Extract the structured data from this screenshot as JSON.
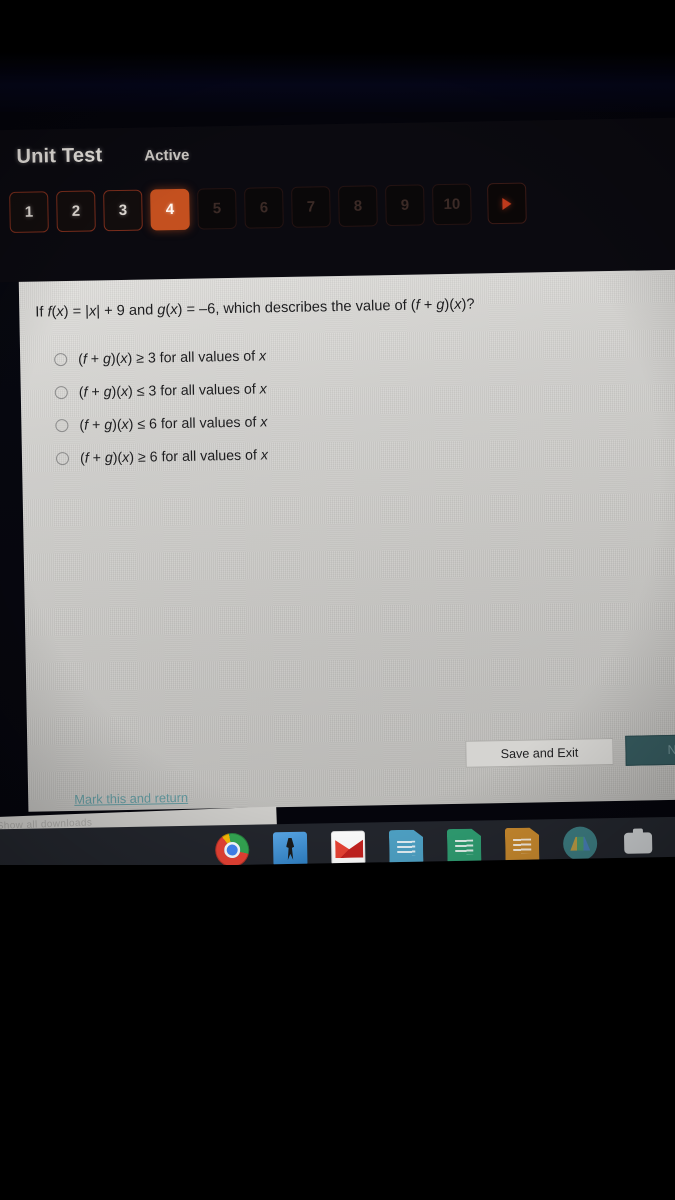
{
  "header": {
    "title": "Unit Test",
    "status": "Active"
  },
  "question_nav": {
    "items": [
      {
        "label": "1",
        "state": "available"
      },
      {
        "label": "2",
        "state": "available"
      },
      {
        "label": "3",
        "state": "available"
      },
      {
        "label": "4",
        "state": "active"
      },
      {
        "label": "5",
        "state": "dim"
      },
      {
        "label": "6",
        "state": "dim"
      },
      {
        "label": "7",
        "state": "dim"
      },
      {
        "label": "8",
        "state": "dim"
      },
      {
        "label": "9",
        "state": "dim"
      },
      {
        "label": "10",
        "state": "dim"
      }
    ],
    "next_icon": "triangle-right-icon"
  },
  "question": {
    "prompt_prefix": "If ",
    "prompt": "If f(x) = |x| + 9 and g(x) = –6, which describes the value of (f + g)(x)?",
    "options": [
      {
        "id": "a",
        "text": "(f + g)(x) ≥ 3 for all values of x",
        "selected": false
      },
      {
        "id": "b",
        "text": "(f + g)(x) ≤ 3 for all values of x",
        "selected": false
      },
      {
        "id": "c",
        "text": "(f + g)(x) ≤ 6 for all values of x",
        "selected": false
      },
      {
        "id": "d",
        "text": "(f + g)(x) ≥ 6 for all values of x",
        "selected": false
      }
    ]
  },
  "actions": {
    "save_and_exit": "Save and Exit",
    "next": "Next",
    "mark_and_return": "Mark this and return"
  },
  "download_bar": {
    "text": "Show all downloads"
  },
  "taskbar": {
    "icons": [
      {
        "name": "chrome-icon"
      },
      {
        "name": "app-icon"
      },
      {
        "name": "gmail-icon"
      },
      {
        "name": "google-docs-icon"
      },
      {
        "name": "google-sheets-icon"
      },
      {
        "name": "google-slides-icon"
      },
      {
        "name": "google-drive-icon"
      },
      {
        "name": "google-photos-icon"
      },
      {
        "name": "pinwheel-icon"
      }
    ]
  },
  "colors": {
    "accent_active": "#c4501f",
    "nav_border": "#7a2d1c",
    "link_teal": "#3f8a93",
    "next_button": "#35595d",
    "panel_bg": "#cfcecb"
  }
}
